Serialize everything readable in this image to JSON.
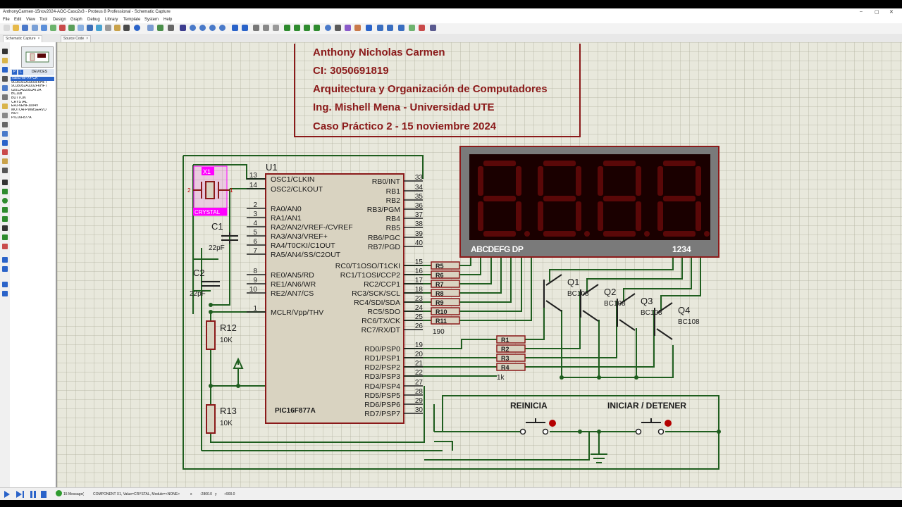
{
  "window": {
    "title": "AnthonyCarmen-15nov2024-AOC-Caso2v3 - Proteus 8 Professional - Schematic Capture",
    "minimize": "–",
    "maximize": "▢",
    "close": "✕"
  },
  "menu": [
    "File",
    "Edit",
    "View",
    "Tool",
    "Design",
    "Graph",
    "Debug",
    "Library",
    "Template",
    "System",
    "Help"
  ],
  "tabs": [
    {
      "label": "Schematic Capture",
      "close": "×"
    },
    {
      "label": "Source Code",
      "close": "×"
    }
  ],
  "devices": {
    "p_button": "P",
    "l_button": "L",
    "header": "DEVICES",
    "items": [
      "7SEG-MPX4-CA",
      "9C06031A1903FKHFT",
      "9C08052A1002FKHFT",
      "0201342205JAT2A",
      "BC108",
      "BUTTON",
      "CRYSTAL",
      "ERJ-6ENF1004V",
      "MOTOR-PWMSERVO",
      "NOT",
      "PIC16F877A"
    ],
    "selected_index": 0
  },
  "title_block": {
    "line1": "Anthony Nicholas Carmen",
    "line2": "CI: 3050691819",
    "line3": "Arquitectura y Organización de Computadores",
    "line4": "Ing. Mishell Mena - Universidad UTE",
    "line5": "Caso Práctico 2   -   15 noviembre 2024"
  },
  "mcu": {
    "ref": "U1",
    "part": "PIC16F877A",
    "left_pins": [
      {
        "num": "13",
        "name": "OSC1/CLKIN"
      },
      {
        "num": "14",
        "name": "OSC2/CLKOUT"
      },
      {
        "num": "2",
        "name": "RA0/AN0"
      },
      {
        "num": "3",
        "name": "RA1/AN1"
      },
      {
        "num": "4",
        "name": "RA2/AN2/VREF-/CVREF"
      },
      {
        "num": "5",
        "name": "RA3/AN3/VREF+"
      },
      {
        "num": "6",
        "name": "RA4/T0CKI/C1OUT"
      },
      {
        "num": "7",
        "name": "RA5/AN4/SS/C2OUT"
      },
      {
        "num": "8",
        "name": "RE0/AN5/RD"
      },
      {
        "num": "9",
        "name": "RE1/AN6/WR"
      },
      {
        "num": "10",
        "name": "RE2/AN7/CS"
      },
      {
        "num": "1",
        "name": "MCLR/Vpp/THV"
      }
    ],
    "right_pins": [
      {
        "num": "33",
        "name": "RB0/INT"
      },
      {
        "num": "34",
        "name": "RB1"
      },
      {
        "num": "35",
        "name": "RB2"
      },
      {
        "num": "36",
        "name": "RB3/PGM"
      },
      {
        "num": "37",
        "name": "RB4"
      },
      {
        "num": "38",
        "name": "RB5"
      },
      {
        "num": "39",
        "name": "RB6/PGC"
      },
      {
        "num": "40",
        "name": "RB7/PGD"
      },
      {
        "num": "15",
        "name": "RC0/T1OSO/T1CKI"
      },
      {
        "num": "16",
        "name": "RC1/T1OSI/CCP2"
      },
      {
        "num": "17",
        "name": "RC2/CCP1"
      },
      {
        "num": "18",
        "name": "RC3/SCK/SCL"
      },
      {
        "num": "23",
        "name": "RC4/SDI/SDA"
      },
      {
        "num": "24",
        "name": "RC5/SDO"
      },
      {
        "num": "25",
        "name": "RC6/TX/CK"
      },
      {
        "num": "26",
        "name": "RC7/RX/DT"
      },
      {
        "num": "19",
        "name": "RD0/PSP0"
      },
      {
        "num": "20",
        "name": "RD1/PSP1"
      },
      {
        "num": "21",
        "name": "RD2/PSP2"
      },
      {
        "num": "22",
        "name": "RD3/PSP3"
      },
      {
        "num": "27",
        "name": "RD4/PSP4"
      },
      {
        "num": "28",
        "name": "RD5/PSP5"
      },
      {
        "num": "29",
        "name": "RD6/PSP6"
      },
      {
        "num": "30",
        "name": "RD7/PSP7"
      }
    ]
  },
  "crystal": {
    "ref": "X1",
    "label": "CRYSTAL",
    "pin1": "1",
    "pin2": "2"
  },
  "caps": [
    {
      "ref": "C1",
      "value": "22pF"
    },
    {
      "ref": "C2",
      "value": "22pF"
    }
  ],
  "resistors_pullup": [
    {
      "ref": "R12",
      "value": "10K"
    },
    {
      "ref": "R13",
      "value": "10K"
    }
  ],
  "segment_resistors": {
    "refs": [
      "R5",
      "R6",
      "R7",
      "R8",
      "R9",
      "R10",
      "R11"
    ],
    "value": "190"
  },
  "digit_resistors": {
    "refs": [
      "R1",
      "R2",
      "R3",
      "R4"
    ],
    "value": "1k"
  },
  "transistors": [
    {
      "ref": "Q1",
      "part": "BC108"
    },
    {
      "ref": "Q2",
      "part": "BC108"
    },
    {
      "ref": "Q3",
      "part": "BC108"
    },
    {
      "ref": "Q4",
      "part": "BC108"
    }
  ],
  "display": {
    "seg_label": "ABCDEFG  DP",
    "digit_label": "1234",
    "digits": 4
  },
  "buttons": [
    {
      "label": "REINICIA"
    },
    {
      "label": "INICIAR / DETENER"
    }
  ],
  "status": {
    "messages": "15 Message(",
    "component": "COMPONENT X1, Value=CRYSTAL, Module=<NONE>",
    "x_label": "x",
    "x_value": "-2800.0",
    "y_label": "y",
    "y_value": "+900.0"
  },
  "colors": {
    "wire": "#1f5e1f",
    "part_outline": "#8b1a1a",
    "part_fill": "#d9d3c1",
    "display_bg": "#1a0000",
    "segment": "#5a0808",
    "highlight": "#ff00ff",
    "accent": "#2a63c9"
  }
}
